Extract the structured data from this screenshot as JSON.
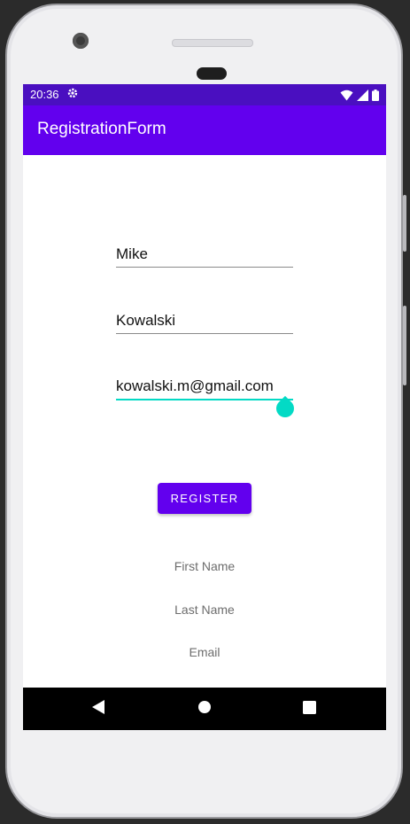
{
  "status_bar": {
    "time": "20:36",
    "icons": [
      "settings-gear-icon",
      "wifi-icon",
      "signal-icon",
      "battery-icon"
    ]
  },
  "app_bar": {
    "title": "RegistrationForm",
    "color": "#6200ee"
  },
  "form": {
    "first_name_value": "Mike",
    "last_name_value": "Kowalski",
    "email_value": "kowalski.m@gmail.com",
    "focused_field": "email"
  },
  "register_button": {
    "label": "REGISTER"
  },
  "output_labels": {
    "first_name": "First Name",
    "last_name": "Last Name",
    "email": "Email"
  },
  "nav_bar": {
    "buttons": [
      "back-icon",
      "home-icon",
      "recents-icon"
    ]
  },
  "colors": {
    "accent": "#03dac5",
    "primary": "#6200ee",
    "status_bar": "#4a0fc0"
  }
}
